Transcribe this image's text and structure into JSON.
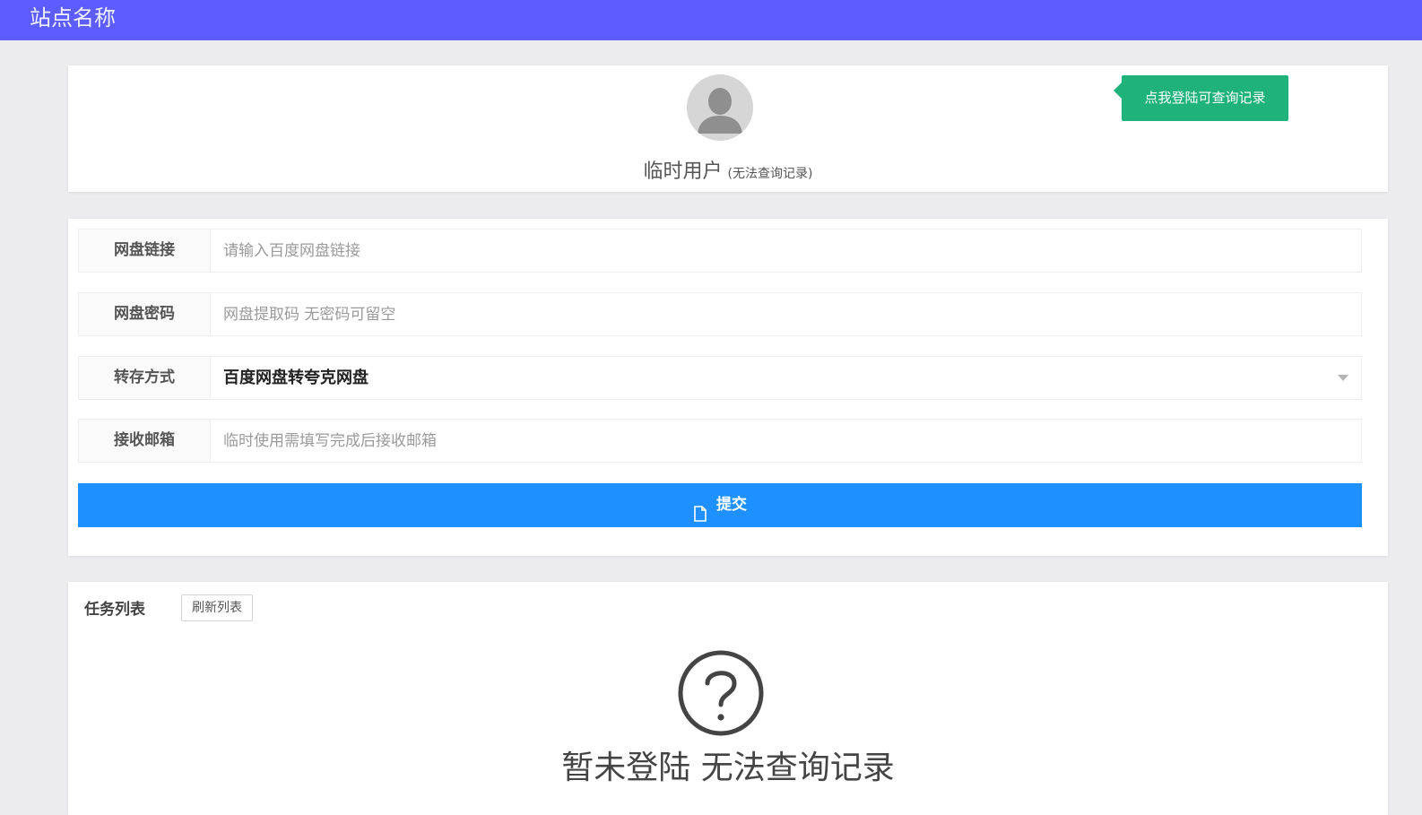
{
  "header": {
    "site_name": "站点名称",
    "bg_color": "#5d5cff"
  },
  "user": {
    "avatar_icon": "user-avatar-icon",
    "name": "临时用户",
    "note": "(无法查询记录)",
    "login_button_label": "点我登陆可查询记录"
  },
  "form": {
    "fields": [
      {
        "label": "网盘链接",
        "placeholder": "请输入百度网盘链接",
        "value": ""
      },
      {
        "label": "网盘密码",
        "placeholder": "网盘提取码 无密码可留空",
        "value": ""
      },
      {
        "label": "转存方式",
        "selected": "百度网盘转夸克网盘"
      },
      {
        "label": "接收邮箱",
        "placeholder": "临时使用需填写完成后接收邮箱",
        "value": ""
      }
    ],
    "submit_label": "提交",
    "submit_icon": "document-icon",
    "submit_color": "#1e90ff"
  },
  "tasks": {
    "title": "任务列表",
    "refresh_label": "刷新列表",
    "empty_icon": "question-circle-icon",
    "empty_message": "暂未登陆 无法查询记录"
  }
}
